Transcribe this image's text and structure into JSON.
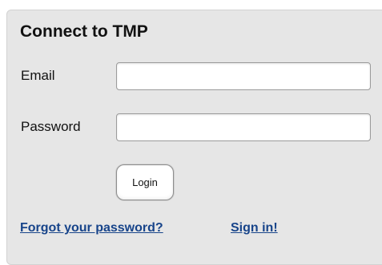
{
  "login_panel": {
    "title": "Connect to TMP",
    "email_label": "Email",
    "email_value": "",
    "email_placeholder": "",
    "password_label": "Password",
    "password_value": "",
    "password_placeholder": "",
    "login_label": "Login",
    "forgot_password_link": "Forgot your password?",
    "sign_in_link": "Sign in!"
  },
  "colors": {
    "panel_background": "#e6e6e6",
    "link": "#17448a",
    "text": "#111111"
  }
}
